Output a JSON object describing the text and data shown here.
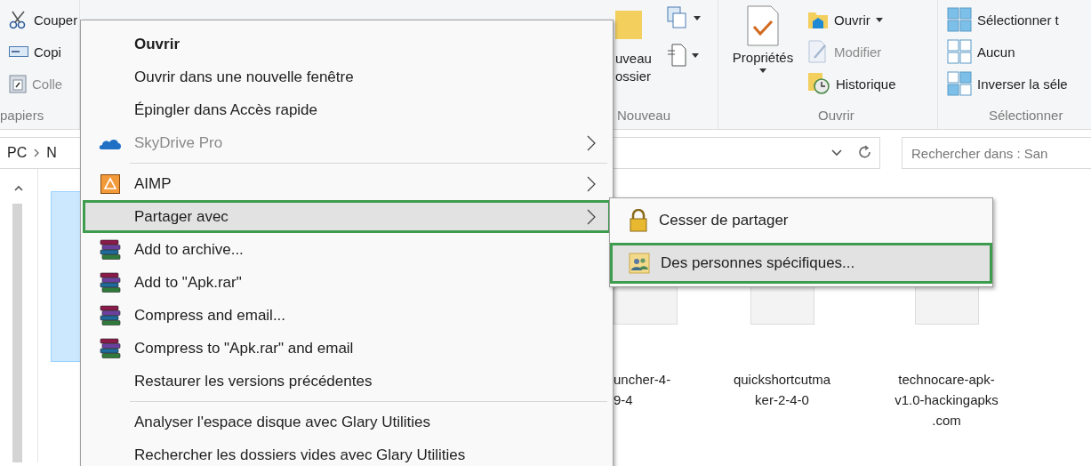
{
  "ribbon": {
    "clipboard": {
      "items": [
        {
          "kind": "cut",
          "label": "Couper",
          "disabled": false
        },
        {
          "kind": "copy",
          "label": "Copi",
          "disabled": false
        },
        {
          "kind": "paste",
          "label": "Colle",
          "disabled": true
        }
      ],
      "label": "papiers"
    },
    "new": {
      "button": "uveau\nossier",
      "label": "Nouveau"
    },
    "open": {
      "properties": {
        "label": "Propriétés",
        "dropdown": true
      },
      "items": [
        {
          "kind": "open",
          "label": "Ouvrir",
          "dropdown": true,
          "disabled": false
        },
        {
          "kind": "edit",
          "label": "Modifier",
          "dropdown": false,
          "disabled": true
        },
        {
          "kind": "history",
          "label": "Historique",
          "dropdown": false,
          "disabled": false
        }
      ],
      "label": "Ouvrir"
    },
    "select": {
      "items": [
        {
          "kind": "all",
          "label": "Sélectionner t"
        },
        {
          "kind": "none",
          "label": "Aucun"
        },
        {
          "kind": "invert",
          "label": "Inverser la séle"
        }
      ],
      "label": "Sélectionner"
    }
  },
  "address": {
    "path": [
      "PC",
      "N"
    ]
  },
  "search": {
    "placeholder": "Rechercher dans : San"
  },
  "files": [
    {
      "selected": true
    },
    {
      "name": "uncher-4-\n9-4",
      "selected": false
    },
    {
      "name": "quickshortcutma\nker-2-4-0",
      "selected": false
    },
    {
      "name": "technocare-apk-\nv1.0-hackingapks\n.com",
      "selected": false
    }
  ],
  "context_menu": {
    "items": [
      {
        "kind": "item",
        "label": "Ouvrir",
        "bold": true,
        "disabled": false,
        "submenu": false,
        "selected": false
      },
      {
        "kind": "item",
        "label": "Ouvrir dans une nouvelle fenêtre",
        "bold": false,
        "disabled": false,
        "submenu": false,
        "selected": false
      },
      {
        "kind": "item",
        "label": "Épingler dans Accès rapide",
        "bold": false,
        "disabled": false,
        "submenu": false,
        "selected": false
      },
      {
        "kind": "item",
        "label": "SkyDrive Pro",
        "bold": false,
        "disabled": true,
        "submenu": true,
        "selected": false
      },
      {
        "kind": "separator"
      },
      {
        "kind": "item",
        "label": "AIMP",
        "bold": false,
        "disabled": false,
        "submenu": true,
        "selected": false
      },
      {
        "kind": "item",
        "label": "Partager avec",
        "bold": false,
        "disabled": false,
        "submenu": true,
        "selected": true
      },
      {
        "kind": "item",
        "label": "Add to archive...",
        "bold": false,
        "disabled": false,
        "submenu": false,
        "selected": false
      },
      {
        "kind": "item",
        "label": "Add to \"Apk.rar\"",
        "bold": false,
        "disabled": false,
        "submenu": false,
        "selected": false
      },
      {
        "kind": "item",
        "label": "Compress and email...",
        "bold": false,
        "disabled": false,
        "submenu": false,
        "selected": false
      },
      {
        "kind": "item",
        "label": "Compress to \"Apk.rar\" and email",
        "bold": false,
        "disabled": false,
        "submenu": false,
        "selected": false
      },
      {
        "kind": "item",
        "label": "Restaurer les versions précédentes",
        "bold": false,
        "disabled": false,
        "submenu": false,
        "selected": false
      },
      {
        "kind": "separator"
      },
      {
        "kind": "item",
        "label": "Analyser l'espace disque avec Glary Utilities",
        "bold": false,
        "disabled": false,
        "submenu": false,
        "selected": false
      },
      {
        "kind": "item",
        "label": "Rechercher les dossiers vides avec Glary Utilities",
        "bold": false,
        "disabled": false,
        "submenu": false,
        "selected": false
      }
    ]
  },
  "submenu": {
    "items": [
      {
        "label": "Cesser de partager",
        "selected": false
      },
      {
        "label": "Des personnes spécifiques...",
        "selected": true
      }
    ]
  }
}
